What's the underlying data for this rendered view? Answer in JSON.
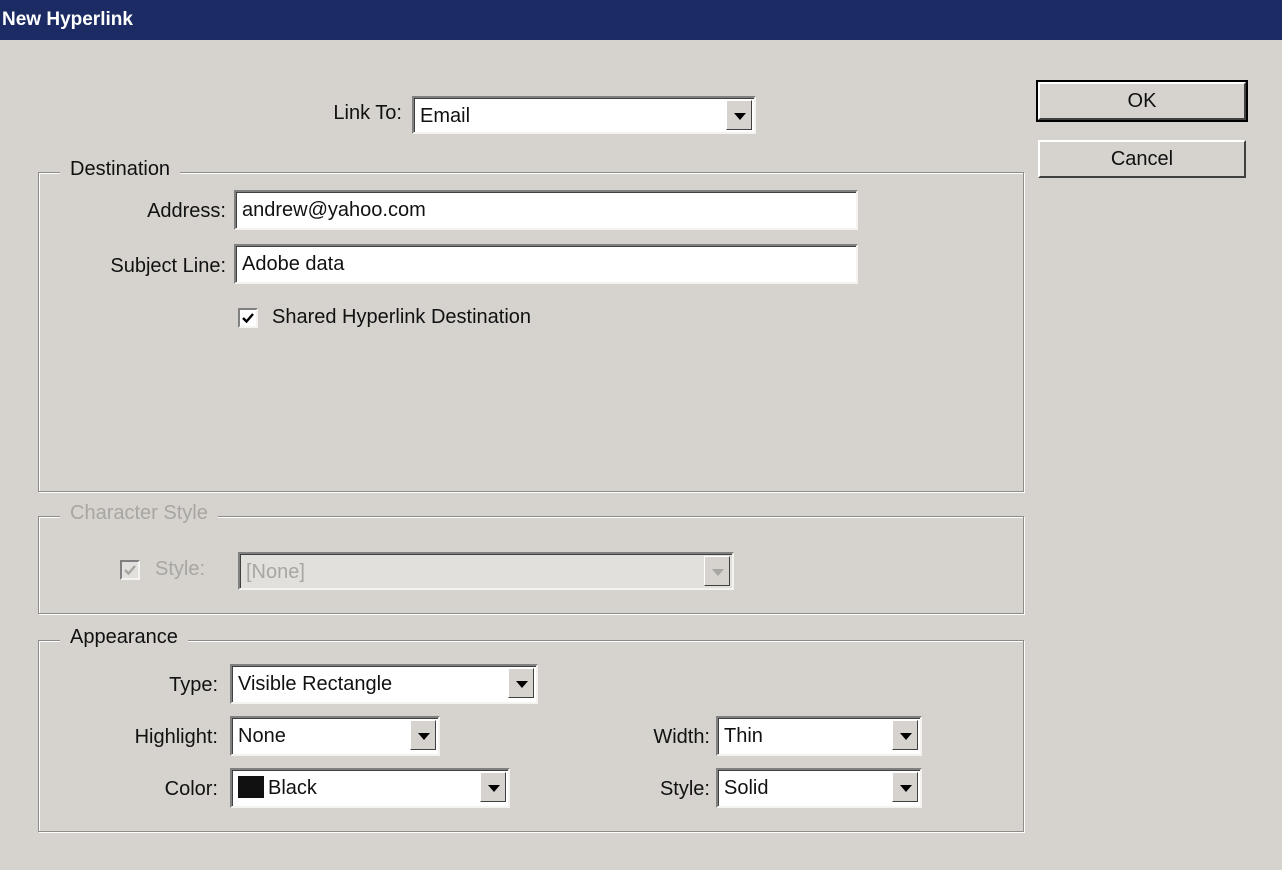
{
  "window": {
    "title": "New Hyperlink"
  },
  "link_to": {
    "label": "Link To:",
    "value": "Email"
  },
  "buttons": {
    "ok": "OK",
    "cancel": "Cancel"
  },
  "destination": {
    "legend": "Destination",
    "address_label": "Address:",
    "address_value": "andrew@yahoo.com",
    "subject_label": "Subject Line:",
    "subject_value": "Adobe data",
    "shared_checkbox_label": "Shared Hyperlink Destination",
    "shared_checked": true
  },
  "character_style": {
    "legend": "Character Style",
    "style_label": "Style:",
    "style_value": "[None]",
    "enabled": false
  },
  "appearance": {
    "legend": "Appearance",
    "type_label": "Type:",
    "type_value": "Visible Rectangle",
    "highlight_label": "Highlight:",
    "highlight_value": "None",
    "color_label": "Color:",
    "color_value": "Black",
    "color_swatch": "#111111",
    "width_label": "Width:",
    "width_value": "Thin",
    "style_label": "Style:",
    "style_value": "Solid"
  },
  "colors": {
    "titlebar": "#1c2b63",
    "dialog_bg": "#d6d3ce",
    "disabled_text": "#a8a6a2"
  }
}
